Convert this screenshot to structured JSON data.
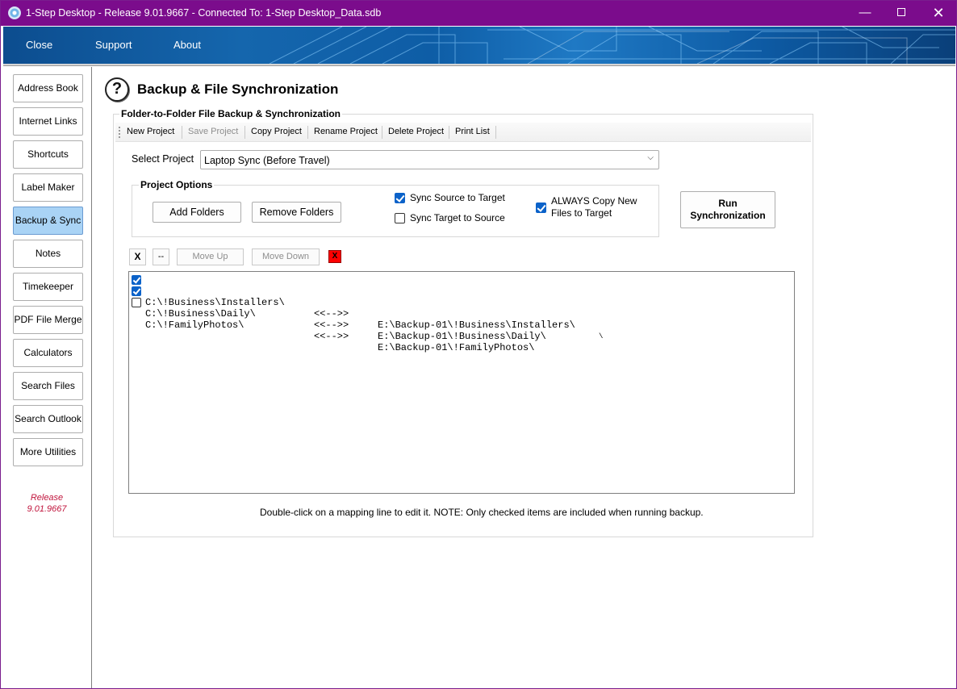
{
  "window": {
    "title": "1-Step Desktop - Release 9.01.9667 - Connected To: 1-Step Desktop_Data.sdb",
    "min_glyph": "—",
    "close_glyph": "✕",
    "accent_color": "#7b0c8c"
  },
  "menu": {
    "items": [
      "Close",
      "Support",
      "About"
    ]
  },
  "sidebar": {
    "items": [
      {
        "label": "Address Book",
        "active": false
      },
      {
        "label": "Internet Links",
        "active": false
      },
      {
        "label": "Shortcuts",
        "active": false
      },
      {
        "label": "Label Maker",
        "active": false
      },
      {
        "label": "Backup & Sync",
        "active": true
      },
      {
        "label": "Notes",
        "active": false
      },
      {
        "label": "Timekeeper",
        "active": false
      },
      {
        "label": "PDF File Merge",
        "active": false
      },
      {
        "label": "Calculators",
        "active": false
      },
      {
        "label": "Search Files",
        "active": false
      },
      {
        "label": "Search Outlook",
        "active": false
      },
      {
        "label": "More Utilities",
        "active": false
      }
    ],
    "release_label": "Release",
    "release_version": "9.01.9667"
  },
  "page": {
    "help_glyph": "?",
    "title": "Backup & File Synchronization",
    "group_title": "Folder-to-Folder File Backup & Synchronization"
  },
  "toolbar": {
    "new_project": "New Project",
    "save_project": "Save Project",
    "copy_project": "Copy Project",
    "rename_project": "Rename Project",
    "delete_project": "Delete Project",
    "print_list": "Print List"
  },
  "project_select": {
    "label": "Select Project",
    "value": "Laptop Sync (Before Travel)",
    "arrow_glyph": "⌵"
  },
  "options": {
    "title": "Project Options",
    "add_folders": "Add Folders",
    "remove_folders": "Remove Folders",
    "sync_source_to_target": {
      "label": "Sync Source to Target",
      "checked": true
    },
    "sync_target_to_source": {
      "label": "Sync Target to Source",
      "checked": false
    },
    "always_copy_new": {
      "line1": "ALWAYS Copy New",
      "line2": "Files to Target",
      "checked": true
    },
    "run_line1": "Run",
    "run_line2": "Synchronization"
  },
  "list_controls": {
    "check_all": "X",
    "uncheck_all": "--",
    "move_up": "Move Up",
    "move_down": "Move Down",
    "delete": "X"
  },
  "mappings": [
    {
      "checked": true,
      "source": "C:\\!Business\\Installers\\",
      "arrow": "<<-->>",
      "target": "E:\\Backup-01\\!Business\\Installers\\",
      "tail": "\\"
    },
    {
      "checked": true,
      "source": "C:\\!Business\\Daily\\",
      "arrow": "<<-->>",
      "target": "E:\\Backup-01\\!Business\\Daily\\",
      "tail": ""
    },
    {
      "checked": false,
      "source": "C:\\!FamilyPhotos\\",
      "arrow": "<<-->>",
      "target": "E:\\Backup-01\\!FamilyPhotos\\",
      "tail": ""
    }
  ],
  "footer_note": "Double-click on a mapping line to edit it.  NOTE: Only checked items are included when running backup."
}
